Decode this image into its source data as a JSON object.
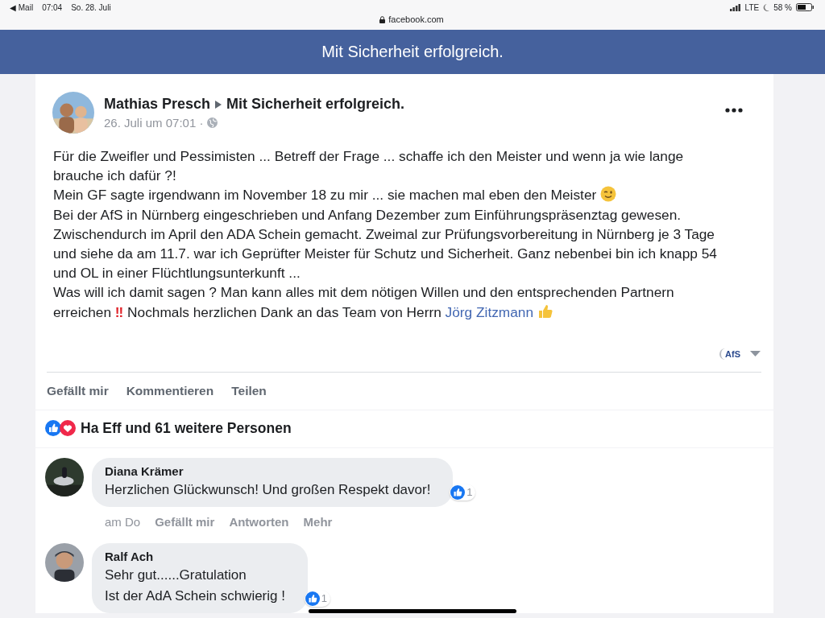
{
  "status_bar": {
    "back_app": "◀ Mail",
    "time": "07:04",
    "date": "So. 28. Juli",
    "url": "facebook.com",
    "network": "LTE",
    "battery": "58 %"
  },
  "header": {
    "title": "Mit Sicherheit erfolgreich."
  },
  "post": {
    "author": "Mathias Presch",
    "group": "Mit Sicherheit erfolgreich.",
    "timestamp": "26. Juli um 07:01 ·",
    "paragraphs": [
      {
        "text": "Für die Zweifler und Pessimisten ... Betreff der Frage ... schaffe ich den Meister und wenn ja wie lange brauche ich dafür ?!"
      },
      {
        "text": "Mein GF sagte irgendwann im November 18 zu mir ... sie machen mal eben den Meister",
        "emoji": {
          "kind": "wink"
        }
      },
      {
        "text": "Bei der AfS in Nürnberg eingeschrieben und Anfang Dezember zum Einführungspräsenztag gewesen. Zwischendurch im April den ADA Schein gemacht. Zweimal zur Prüfungsvorbereitung in Nürnberg je 3 Tage und siehe da am 11.7. war ich Geprüfter Meister für Schutz und Sicherheit. Ganz nebenbei bin ich knapp 54 und OL in einer Flüchtlungsunterkunft ..."
      },
      {
        "text": "Was will ich damit sagen ? Man kann alles mit dem nötigen Willen und den entsprechenden Partnern erreichen",
        "alert": "‼",
        "text_after": "Nochmals herzlichen Dank an das Team von Herrn",
        "link": "Jörg Zitzmann",
        "emoji": {
          "kind": "thumbs_up"
        }
      }
    ],
    "page_badge": "AfS",
    "actions": [
      "Gefällt mir",
      "Kommentieren",
      "Teilen"
    ],
    "reactions": "Ha Eff und 61 weitere Personen"
  },
  "comments": [
    {
      "author": "Diana Krämer",
      "lines": [
        "Herzlichen Glückwunsch! Und großen Respekt davor!"
      ],
      "likes": "1",
      "time": "am Do",
      "actions": [
        "Gefällt mir",
        "Antworten",
        "Mehr"
      ]
    },
    {
      "author": "Ralf Ach",
      "lines": [
        "Sehr gut......Gratulation",
        "Ist der AdA Schein schwierig !"
      ],
      "likes": "1"
    }
  ]
}
